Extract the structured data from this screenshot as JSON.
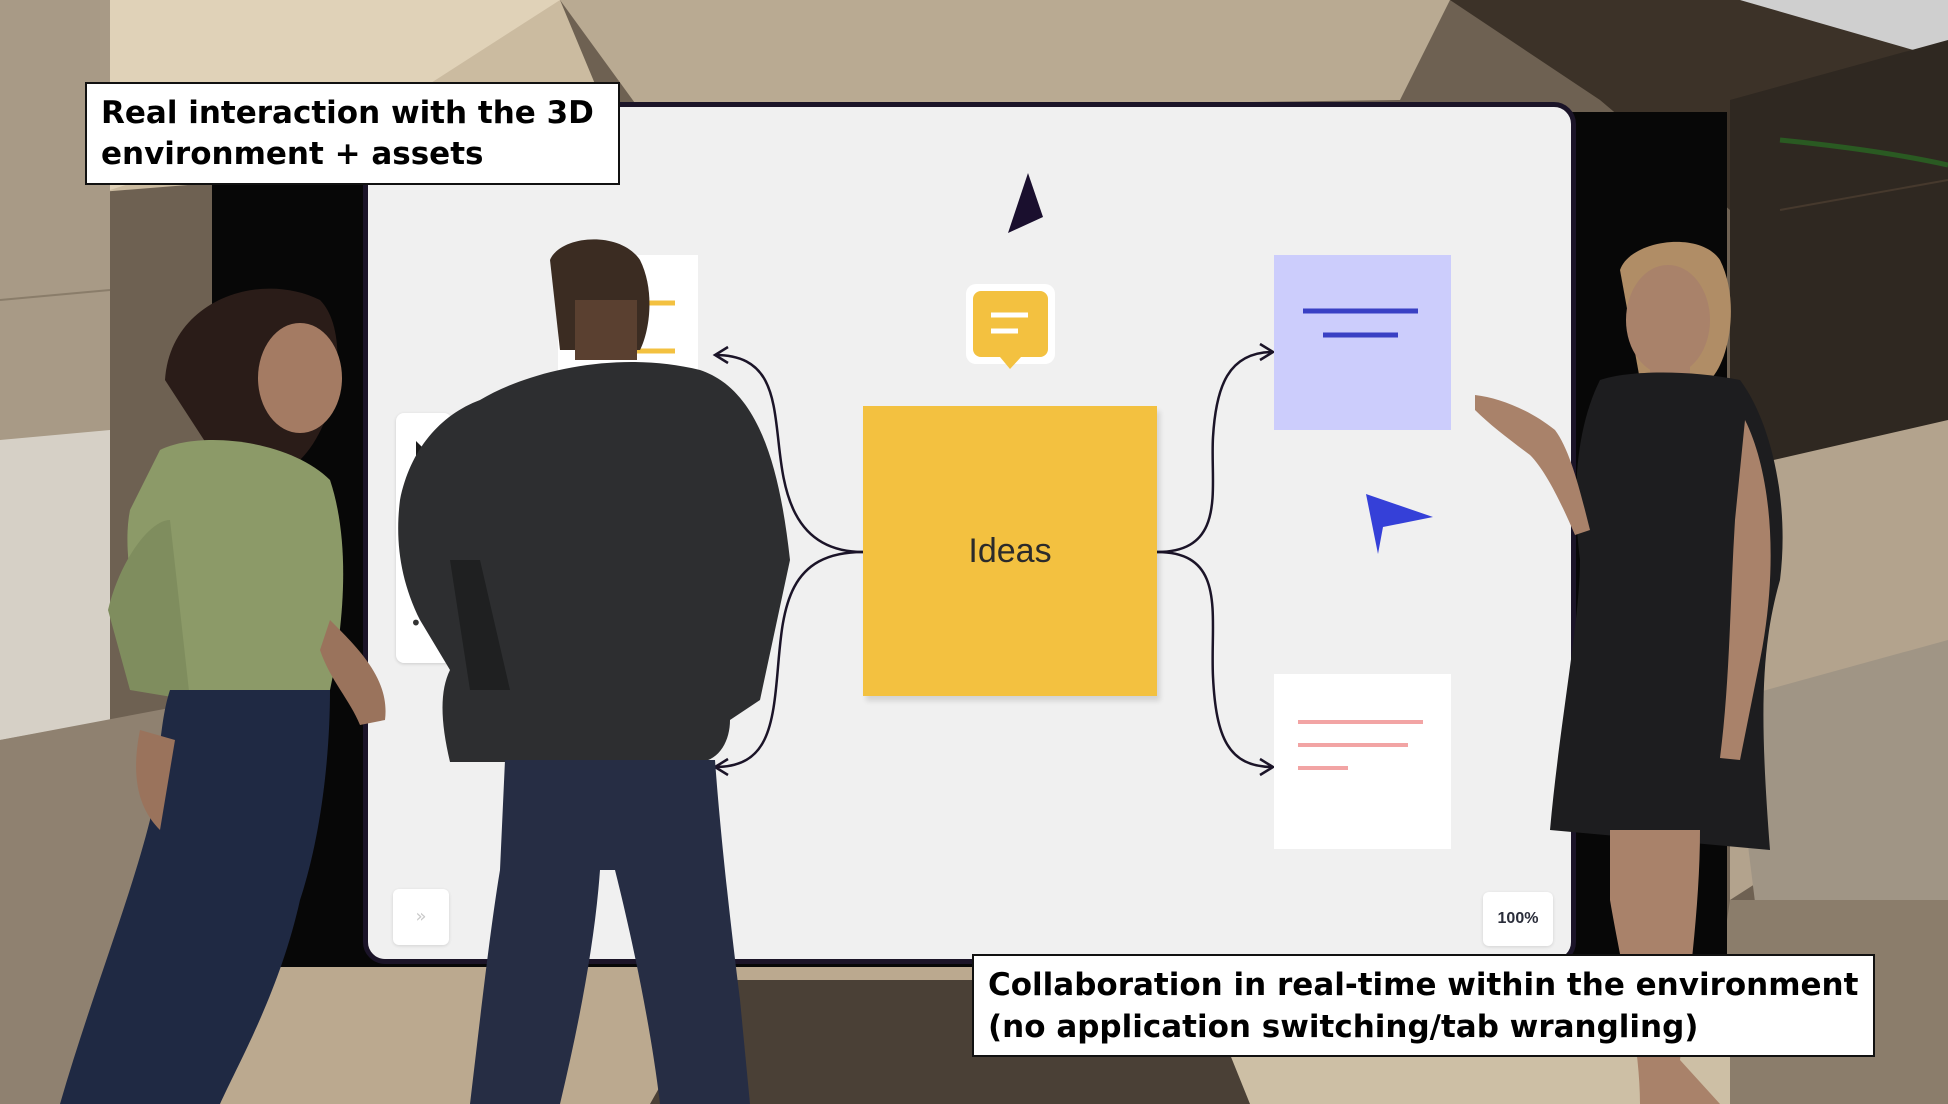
{
  "captions": {
    "top": "Real interaction with the 3D\nenvironment + assets",
    "bottom": "Collaboration in real-time within the environment\n(no application switching/tab wrangling)"
  },
  "whiteboard": {
    "center_note_label": "Ideas",
    "zoom_label": "100%",
    "expand_label": "»",
    "toolbar_more": "••",
    "icons": [
      "cursor-arrow-icon",
      "comment-bubble-icon",
      "collaborator-cursor-icon",
      "expand-chevrons-icon",
      "more-dots-icon"
    ],
    "colors": {
      "board_background": "#f0f0f0",
      "board_frame": "#1b1428",
      "center_note": "#f3c140",
      "lavender_note": "#cccdfc",
      "lavender_lines": "#3940c4",
      "salmon_lines": "#f2a4a4",
      "cursor_dark": "#1a0f2e",
      "cursor_blue": "#3540d8"
    }
  }
}
